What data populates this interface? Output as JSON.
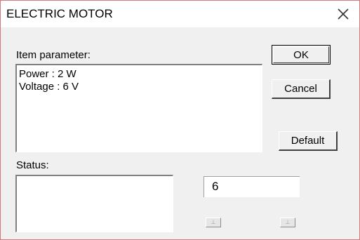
{
  "window": {
    "title": "ELECTRIC MOTOR"
  },
  "labels": {
    "item_parameter": "Item parameter:",
    "status": "Status:"
  },
  "parameters": [
    "Power : 2 W",
    "Voltage : 6 V"
  ],
  "buttons": {
    "ok": "OK",
    "cancel": "Cancel",
    "default": "Default"
  },
  "value_field": {
    "value": "6"
  },
  "spinners": {
    "left_glyph": "⊥",
    "right_glyph": "⊥"
  },
  "icons": {
    "close": "close-icon"
  }
}
